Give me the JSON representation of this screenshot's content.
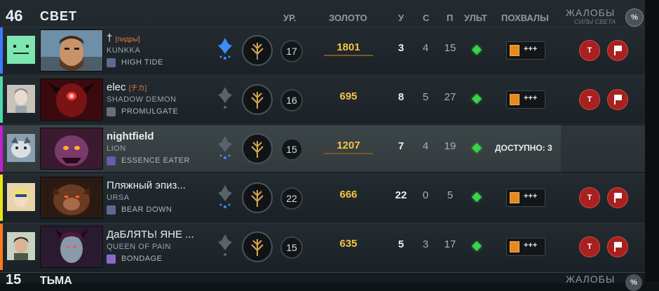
{
  "header": {
    "score": "46",
    "team": "СВЕТ",
    "col_level": "УР.",
    "col_gold": "ЗОЛОТО",
    "col_kills": "У",
    "col_deaths": "С",
    "col_assists": "П",
    "col_ult": "УЛЬТ",
    "col_praise": "ПОХВАЛЫ",
    "complaints": "ЖАЛОБЫ",
    "complaints_sub": "СИЛЫ СВЕТА",
    "toggle": "%"
  },
  "players": [
    {
      "name": "† [пидры]",
      "name_main": "†",
      "name_tag": "[пидры]",
      "hero": "KUNKKA",
      "talent": "HIGH TIDE",
      "level": "17",
      "gold": "1801",
      "kills": "3",
      "deaths": "4",
      "assists": "15",
      "praise": "+++",
      "stripe": "#3a7bff",
      "mute": "T"
    },
    {
      "name": "elec",
      "name_main": "elec",
      "name_tag": "[チカ]",
      "hero": "SHADOW DEMON",
      "talent": "PROMULGATE",
      "level": "16",
      "gold": "695",
      "kills": "8",
      "deaths": "5",
      "assists": "27",
      "praise": "+++",
      "stripe": "#4ed9a8",
      "mute": "T"
    },
    {
      "name": "nightfield",
      "name_main": "nightfield",
      "name_tag": "",
      "hero": "LION",
      "talent": "ESSENCE EATER",
      "level": "15",
      "gold": "1207",
      "kills": "7",
      "deaths": "4",
      "assists": "19",
      "available": "ДОСТУПНО: 3",
      "stripe": "#c21fd1"
    },
    {
      "name": "Пляжный эпиз...",
      "name_main": "Пляжный эпиз...",
      "name_tag": "",
      "hero": "URSA",
      "talent": "BEAR DOWN",
      "level": "22",
      "gold": "666",
      "kills": "22",
      "deaths": "0",
      "assists": "5",
      "praise": "+++",
      "stripe": "#e6e615",
      "mute": "T"
    },
    {
      "name": "ДаБЛЯТЬ! ЯНЕ ...",
      "name_main": "ДаБЛЯТЬ! ЯНЕ ...",
      "name_tag": "",
      "hero": "QUEEN OF PAIN",
      "talent": "BONDAGE",
      "level": "15",
      "gold": "635",
      "kills": "5",
      "deaths": "3",
      "assists": "17",
      "praise": "+++",
      "stripe": "#ff7a1a",
      "mute": "T"
    }
  ],
  "bottom": {
    "score": "15",
    "team": "ТЬМА",
    "complaints": "ЖАЛОБЫ",
    "toggle": "%"
  },
  "colors": {
    "gold": "#f4c443",
    "ult_ready": "#3bd24a",
    "report": "#a8201f"
  }
}
